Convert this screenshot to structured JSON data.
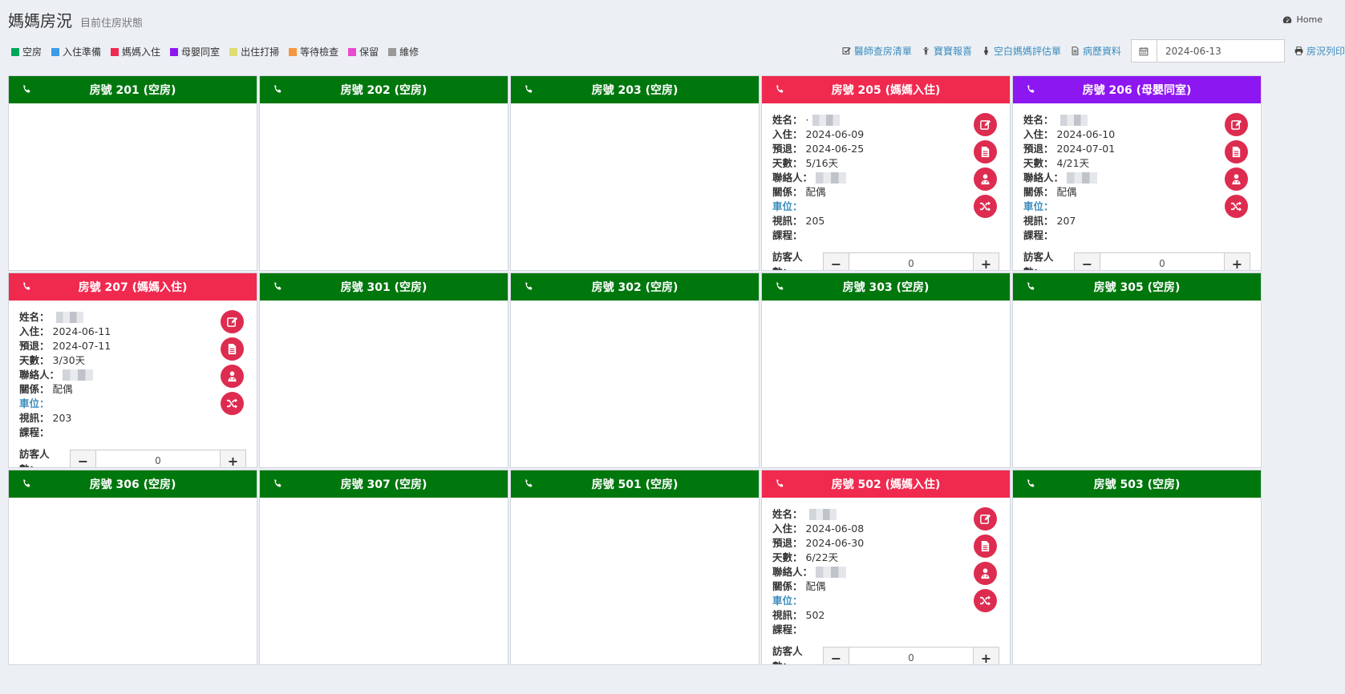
{
  "header": {
    "title": "媽媽房況",
    "subtitle": "目前住房狀態",
    "home": "Home"
  },
  "legend": [
    {
      "label": "空房",
      "color": "#00a65a"
    },
    {
      "label": "入住準備",
      "color": "#3c9ae8"
    },
    {
      "label": "媽媽入住",
      "color": "#f0294f"
    },
    {
      "label": "母嬰同室",
      "color": "#8d17f0"
    },
    {
      "label": "出住打掃",
      "color": "#dede74"
    },
    {
      "label": "等待檢查",
      "color": "#f7963e"
    },
    {
      "label": "保留",
      "color": "#e84ad0"
    },
    {
      "label": "維修",
      "color": "#999999"
    }
  ],
  "toolbar": {
    "doctor_rounds": "醫師查房清單",
    "baby_report": "寶寶報喜",
    "blank_assessment": "空白媽媽評估單",
    "medical_records": "病歷資料",
    "date": "2024-06-13",
    "print": "房況列印"
  },
  "colors": {
    "empty": "#00770d",
    "occupied": "#f0294f",
    "rooming_in": "#8d17f0",
    "action": "#dd2c4f",
    "link": "#3c8dbc"
  },
  "labels": {
    "name": "姓名：",
    "checkin": "入住：",
    "checkout": "預退：",
    "days": "天數：",
    "contact": "聯絡人：",
    "relation": "關係：",
    "parking": "車位：",
    "video": "視訊：",
    "course": "課程：",
    "visitors": "訪客人數："
  },
  "rooms": [
    {
      "title": "房號 201 (空房)",
      "status": "empty"
    },
    {
      "title": "房號 202 (空房)",
      "status": "empty"
    },
    {
      "title": "房號 203 (空房)",
      "status": "empty"
    },
    {
      "title": "房號 205 (媽媽入住)",
      "status": "occupied",
      "name_prefix": "·",
      "checkin": "2024-06-09",
      "checkout": "2024-06-25",
      "days": "5/16天",
      "relation": "配偶",
      "parking": "",
      "video": "205",
      "course": "",
      "visitors": "0"
    },
    {
      "title": "房號 206 (母嬰同室)",
      "status": "rooming_in",
      "name_prefix": "",
      "checkin": "2024-06-10",
      "checkout": "2024-07-01",
      "days": "4/21天",
      "relation": "配偶",
      "parking": "",
      "video": "207",
      "course": "",
      "visitors": "0"
    },
    {
      "title": "房號 207 (媽媽入住)",
      "status": "occupied",
      "name_prefix": "",
      "checkin": "2024-06-11",
      "checkout": "2024-07-11",
      "days": "3/30天",
      "relation": "配偶",
      "parking": "",
      "video": "203",
      "course": "",
      "visitors": "0"
    },
    {
      "title": "房號 301 (空房)",
      "status": "empty"
    },
    {
      "title": "房號 302 (空房)",
      "status": "empty"
    },
    {
      "title": "房號 303 (空房)",
      "status": "empty"
    },
    {
      "title": "房號 305 (空房)",
      "status": "empty"
    },
    {
      "title": "房號 306 (空房)",
      "status": "empty"
    },
    {
      "title": "房號 307 (空房)",
      "status": "empty"
    },
    {
      "title": "房號 501 (空房)",
      "status": "empty"
    },
    {
      "title": "房號 502 (媽媽入住)",
      "status": "occupied",
      "name_prefix": "",
      "checkin": "2024-06-08",
      "checkout": "2024-06-30",
      "days": "6/22天",
      "relation": "配偶",
      "parking": "",
      "video": "502",
      "course": "",
      "visitors": "0"
    },
    {
      "title": "房號 503 (空房)",
      "status": "empty"
    }
  ]
}
